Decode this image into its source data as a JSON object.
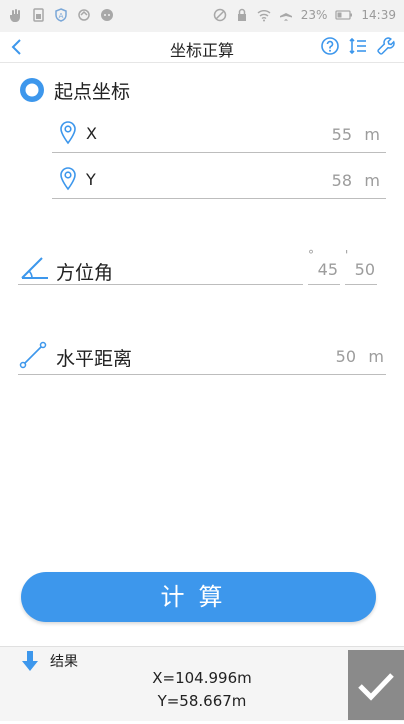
{
  "status_bar": {
    "battery_percent": "23%",
    "time": "14:39",
    "icons_left": [
      "hand-icon",
      "sim-icon",
      "shield-a-icon",
      "sync-icon",
      "chat-icon"
    ],
    "icons_right": [
      "no-signal-icon",
      "lock-icon",
      "wifi-icon",
      "airplane-icon",
      "battery-icon"
    ]
  },
  "title_bar": {
    "title": "坐标正算",
    "left_icon": "chevron-left-icon",
    "right_icons": [
      "help-icon",
      "list-icon",
      "wrench-icon"
    ]
  },
  "origin": {
    "title": "起点坐标",
    "x": {
      "label": "X",
      "value": "55",
      "unit": "m"
    },
    "y": {
      "label": "Y",
      "value": "58",
      "unit": "m"
    }
  },
  "azimuth": {
    "label": "方位角",
    "degrees": "",
    "minutes": "45",
    "seconds": "50",
    "degree_mark": "°",
    "minute_mark": "'"
  },
  "distance": {
    "label": "水平距离",
    "value": "50",
    "unit": "m"
  },
  "calculate_button": {
    "label": "计算"
  },
  "result": {
    "label": "结果",
    "x": "X=104.996m",
    "y": "Y=58.667m"
  },
  "colors": {
    "accent": "#3d97ec",
    "text": "#222222",
    "hint": "#9c9c9c",
    "check_bg": "#8a8a8a"
  }
}
